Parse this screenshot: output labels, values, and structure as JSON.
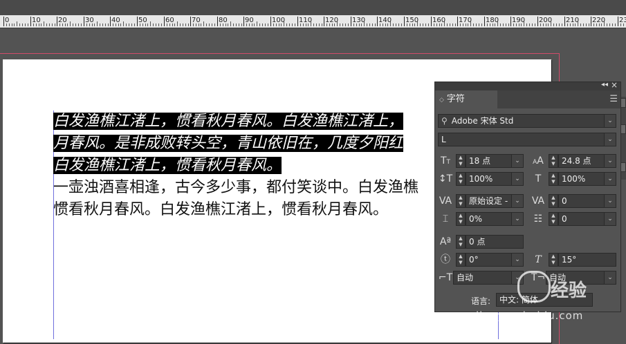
{
  "ruler": {
    "labels": [
      "0",
      "10",
      "20",
      "30",
      "40",
      "50",
      "60",
      "70",
      "80",
      "90",
      "100",
      "110",
      "120",
      "130",
      "140",
      "150",
      "160",
      "170",
      "180",
      "190",
      "200",
      "210",
      "220",
      "230"
    ]
  },
  "document": {
    "lines": [
      {
        "text": "白发渔樵江渚上，惯看秋月春风。白发渔樵江渚上，",
        "selected": true
      },
      {
        "text": "月春风。是非成败转头空，青山依旧在，几度夕阳红",
        "selected": true
      },
      {
        "text": "白发渔樵江渚上，惯看秋月春风。",
        "selected": true
      },
      {
        "text": "一壶浊酒喜相逢，古今多少事，都付笑谈中。白发渔樵",
        "selected": false
      },
      {
        "text": "惯看秋月春风。白发渔樵江渚上，惯看秋月春风。",
        "selected": false
      }
    ]
  },
  "panel": {
    "tab_label": "字符",
    "font_family": "Adobe 宋体 Std",
    "font_style": "L",
    "font_size": "18 点",
    "leading": "24.8 点",
    "vertical_scale": "100%",
    "horizontal_scale": "100%",
    "kerning": "原始设定 -",
    "tracking": "0",
    "tsume": "0%",
    "grid_tracking": "0",
    "baseline_shift": "0 点",
    "rotation": "0°",
    "skew": "15°",
    "aki_before": "自动",
    "aki_after": "自动",
    "language_label": "语言:",
    "language_value": "中文: 简体"
  },
  "watermark": {
    "brand": "经验",
    "url": "jingyan.baidu.com"
  }
}
